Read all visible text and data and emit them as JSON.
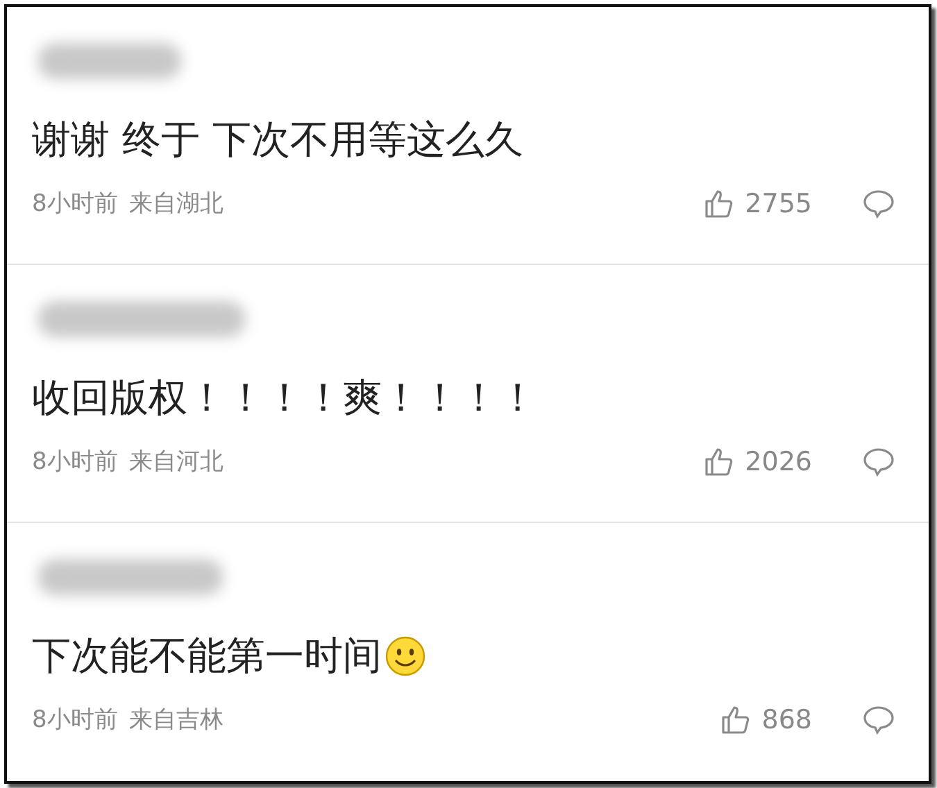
{
  "comments": [
    {
      "text": "谢谢 终于 下次不用等这么久",
      "time": "8小时前",
      "location": "来自湖北",
      "likes": "2755"
    },
    {
      "text": "收回版权！！！！爽！！！！",
      "time": "8小时前",
      "location": "来自河北",
      "likes": "2026"
    },
    {
      "text": "下次能不能第一时间",
      "emoji": true,
      "time": "8小时前",
      "location": "来自吉林",
      "likes": "868"
    }
  ]
}
